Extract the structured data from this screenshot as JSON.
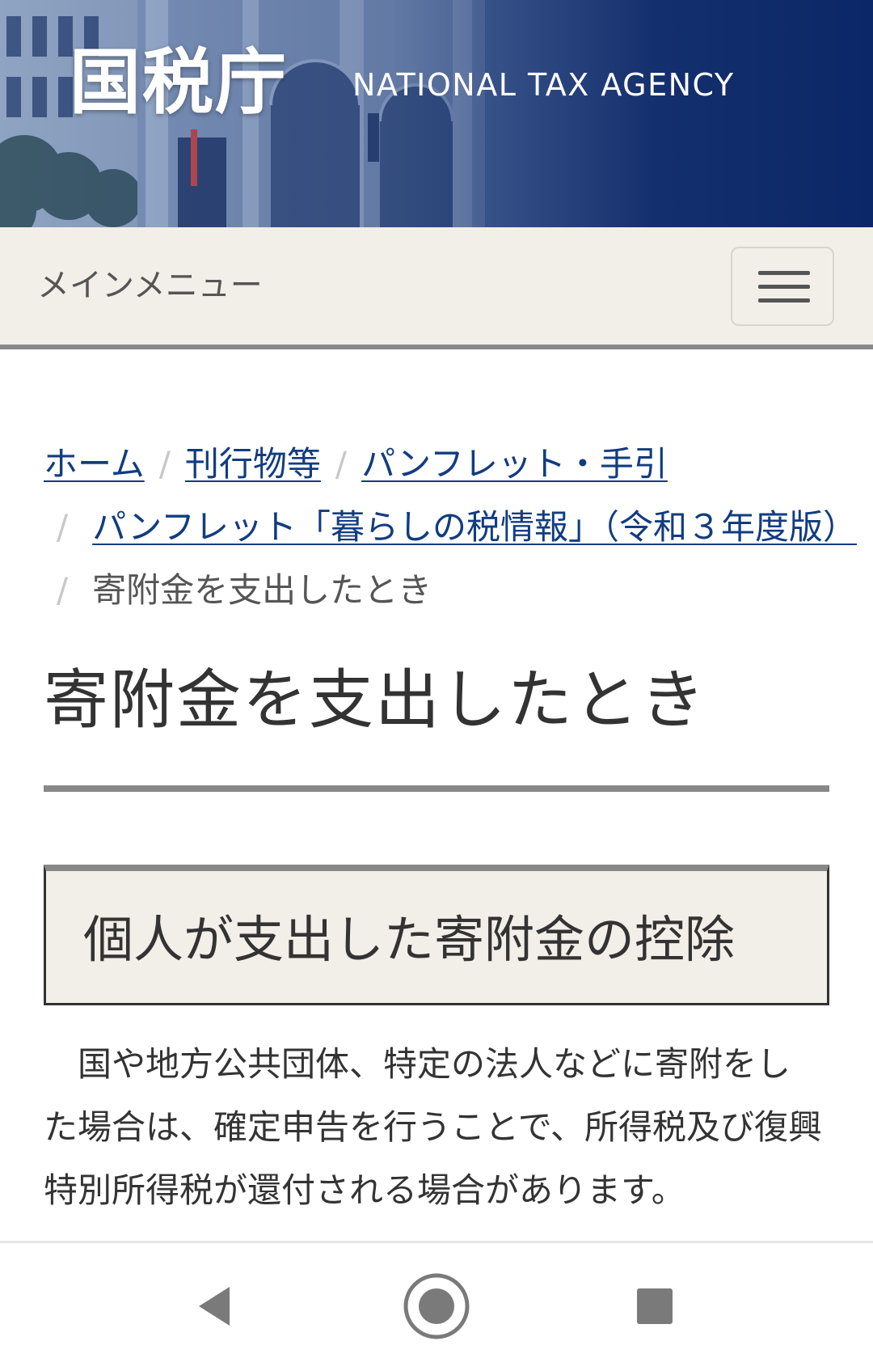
{
  "header": {
    "logo_jp": "国税庁",
    "logo_en": "NATIONAL TAX AGENCY",
    "building_image": "tax-agency-building-photo"
  },
  "menubar": {
    "label": "メインメニュー",
    "toggle_icon": "hamburger-menu-icon"
  },
  "breadcrumb": {
    "separator": "/",
    "items": [
      {
        "label": "ホーム"
      },
      {
        "label": "刊行物等"
      },
      {
        "label": "パンフレット・手引"
      },
      {
        "label": "パンフレット「暮らしの税情報」（令和３年度版）"
      }
    ],
    "current": "寄附金を支出したとき"
  },
  "page": {
    "title": "寄附金を支出したとき"
  },
  "section": {
    "title": "個人が支出した寄附金の控除",
    "body_lines": [
      "　国や地方公共団体、特定の法人などに寄附をし",
      "た場合は、確定申告を行うことで、所得税及び復興",
      "特別所得税が還付される場合があります。"
    ]
  },
  "navbar": {
    "back_icon": "back-triangle-icon",
    "home_icon": "home-circle-icon",
    "recents_icon": "recents-square-icon"
  },
  "colors": {
    "header_navy": "#0c2767",
    "menu_bg": "#f2eee8",
    "link": "#123c80",
    "rule_gray": "#888888",
    "text": "#333333"
  }
}
